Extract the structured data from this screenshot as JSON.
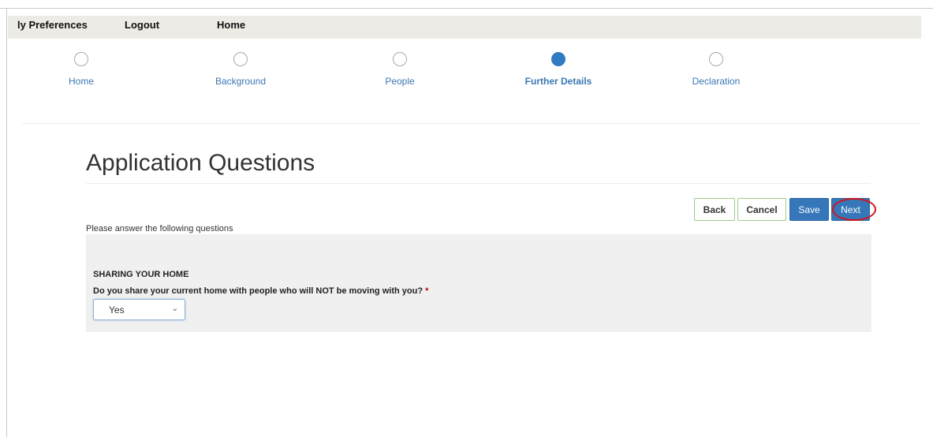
{
  "topnav": {
    "items": [
      "ly Preferences",
      "Logout",
      "Home"
    ]
  },
  "stepper": {
    "steps": [
      {
        "label": "Home",
        "active": false
      },
      {
        "label": "Background",
        "active": false
      },
      {
        "label": "People",
        "active": false
      },
      {
        "label": "Further Details",
        "active": true
      },
      {
        "label": "Declaration",
        "active": false
      }
    ]
  },
  "page": {
    "title": "Application Questions",
    "intro": "Please answer the following questions"
  },
  "actions": {
    "back_label": "Back",
    "cancel_label": "Cancel",
    "save_label": "Save",
    "next_label": "Next"
  },
  "section": {
    "title": "SHARING YOUR HOME",
    "question": "Do you share your current home with people who will NOT be moving with you?",
    "required_marker": "*",
    "selected_value": "Yes"
  },
  "colors": {
    "accent": "#3577b9",
    "active_step": "#2f7ac1",
    "highlight": "#d4141c",
    "outline_button_border": "#9ccb8a"
  }
}
